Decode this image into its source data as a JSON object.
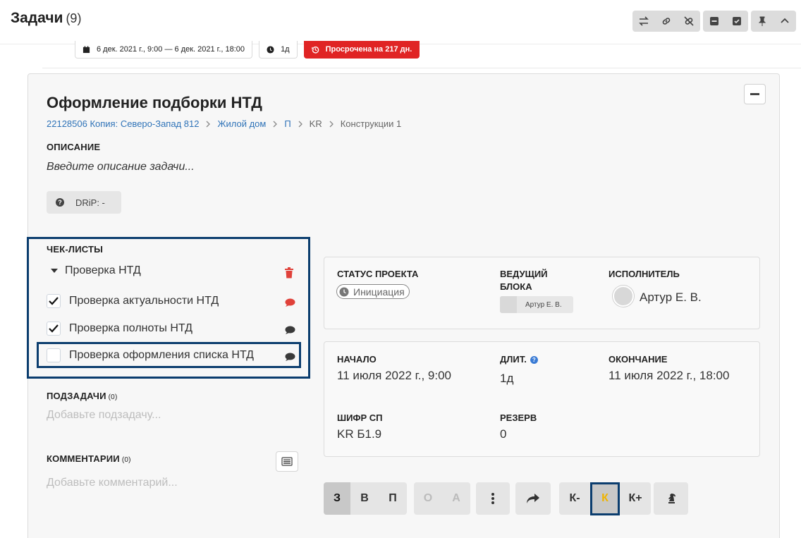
{
  "header": {
    "title": "Задачи",
    "count": "(9)",
    "tools": [
      "swap-icon",
      "link-icon",
      "unlink-icon",
      "minimize-icon",
      "check-square-icon",
      "pin-icon",
      "chevron-up-icon"
    ]
  },
  "prev_task": {
    "dates": "6 дек. 2021 г., 9:00 — 6 дек. 2021 г., 18:00",
    "duration": "1д",
    "overdue": "Просрочена на 217 дн."
  },
  "task": {
    "title": "Оформление подборки НТД",
    "breadcrumbs": [
      "22128506 Копия: Северо-Запад 812",
      "Жилой дом",
      "П",
      "KR",
      "Конструкции 1"
    ],
    "description_label": "ОПИСАНИЕ",
    "description_placeholder": "Введите описание задачи...",
    "drip": "DRiP: -"
  },
  "checklists": {
    "label": "ЧЕК-ЛИСТЫ",
    "group": "Проверка НТД",
    "items": [
      {
        "label": "Проверка актуальности НТД",
        "checked": true,
        "comment_color": "#e0413a"
      },
      {
        "label": "Проверка полноты НТД",
        "checked": true,
        "comment_color": "#3a3a3a"
      },
      {
        "label": "Проверка оформления списка НТД",
        "checked": false,
        "comment_color": "#3a3a3a"
      }
    ]
  },
  "subtasks": {
    "label": "ПОДЗАДАЧИ",
    "count": "(0)",
    "placeholder": "Добавьте подзадачу..."
  },
  "comments": {
    "label": "КОММЕНТАРИИ",
    "count": "(0)",
    "placeholder": "Добавьте комментарий..."
  },
  "info": {
    "status_label": "СТАТУС ПРОЕКТА",
    "status_value": "Инициация",
    "lead_label_1": "ВЕДУЩИЙ",
    "lead_label_2": "БЛОКА",
    "lead_value": "Артур Е. В.",
    "exec_label": "ИСПОЛНИТЕЛЬ",
    "exec_value": "Артур Е. В."
  },
  "dates": {
    "start_label": "НАЧАЛО",
    "start_value": "11 июля 2022 г., 9:00",
    "dur_label": "ДЛИТ.",
    "dur_value": "1д",
    "end_label": "ОКОНЧАНИЕ",
    "end_value": "11 июля 2022 г., 18:00",
    "code_label": "ШИФР СП",
    "code_value": "KR Б1.9",
    "reserve_label": "РЕЗЕРВ",
    "reserve_value": "0"
  },
  "toolbar": {
    "group1": [
      "З",
      "В",
      "П"
    ],
    "group2": [
      "О",
      "А"
    ],
    "group4": [
      "К-",
      "К",
      "К+"
    ]
  },
  "colors": {
    "accent_blue": "#2f73b8",
    "overdue_red": "#e02424",
    "highlight_navy": "#0b3d6e",
    "gold": "#f0b400"
  }
}
